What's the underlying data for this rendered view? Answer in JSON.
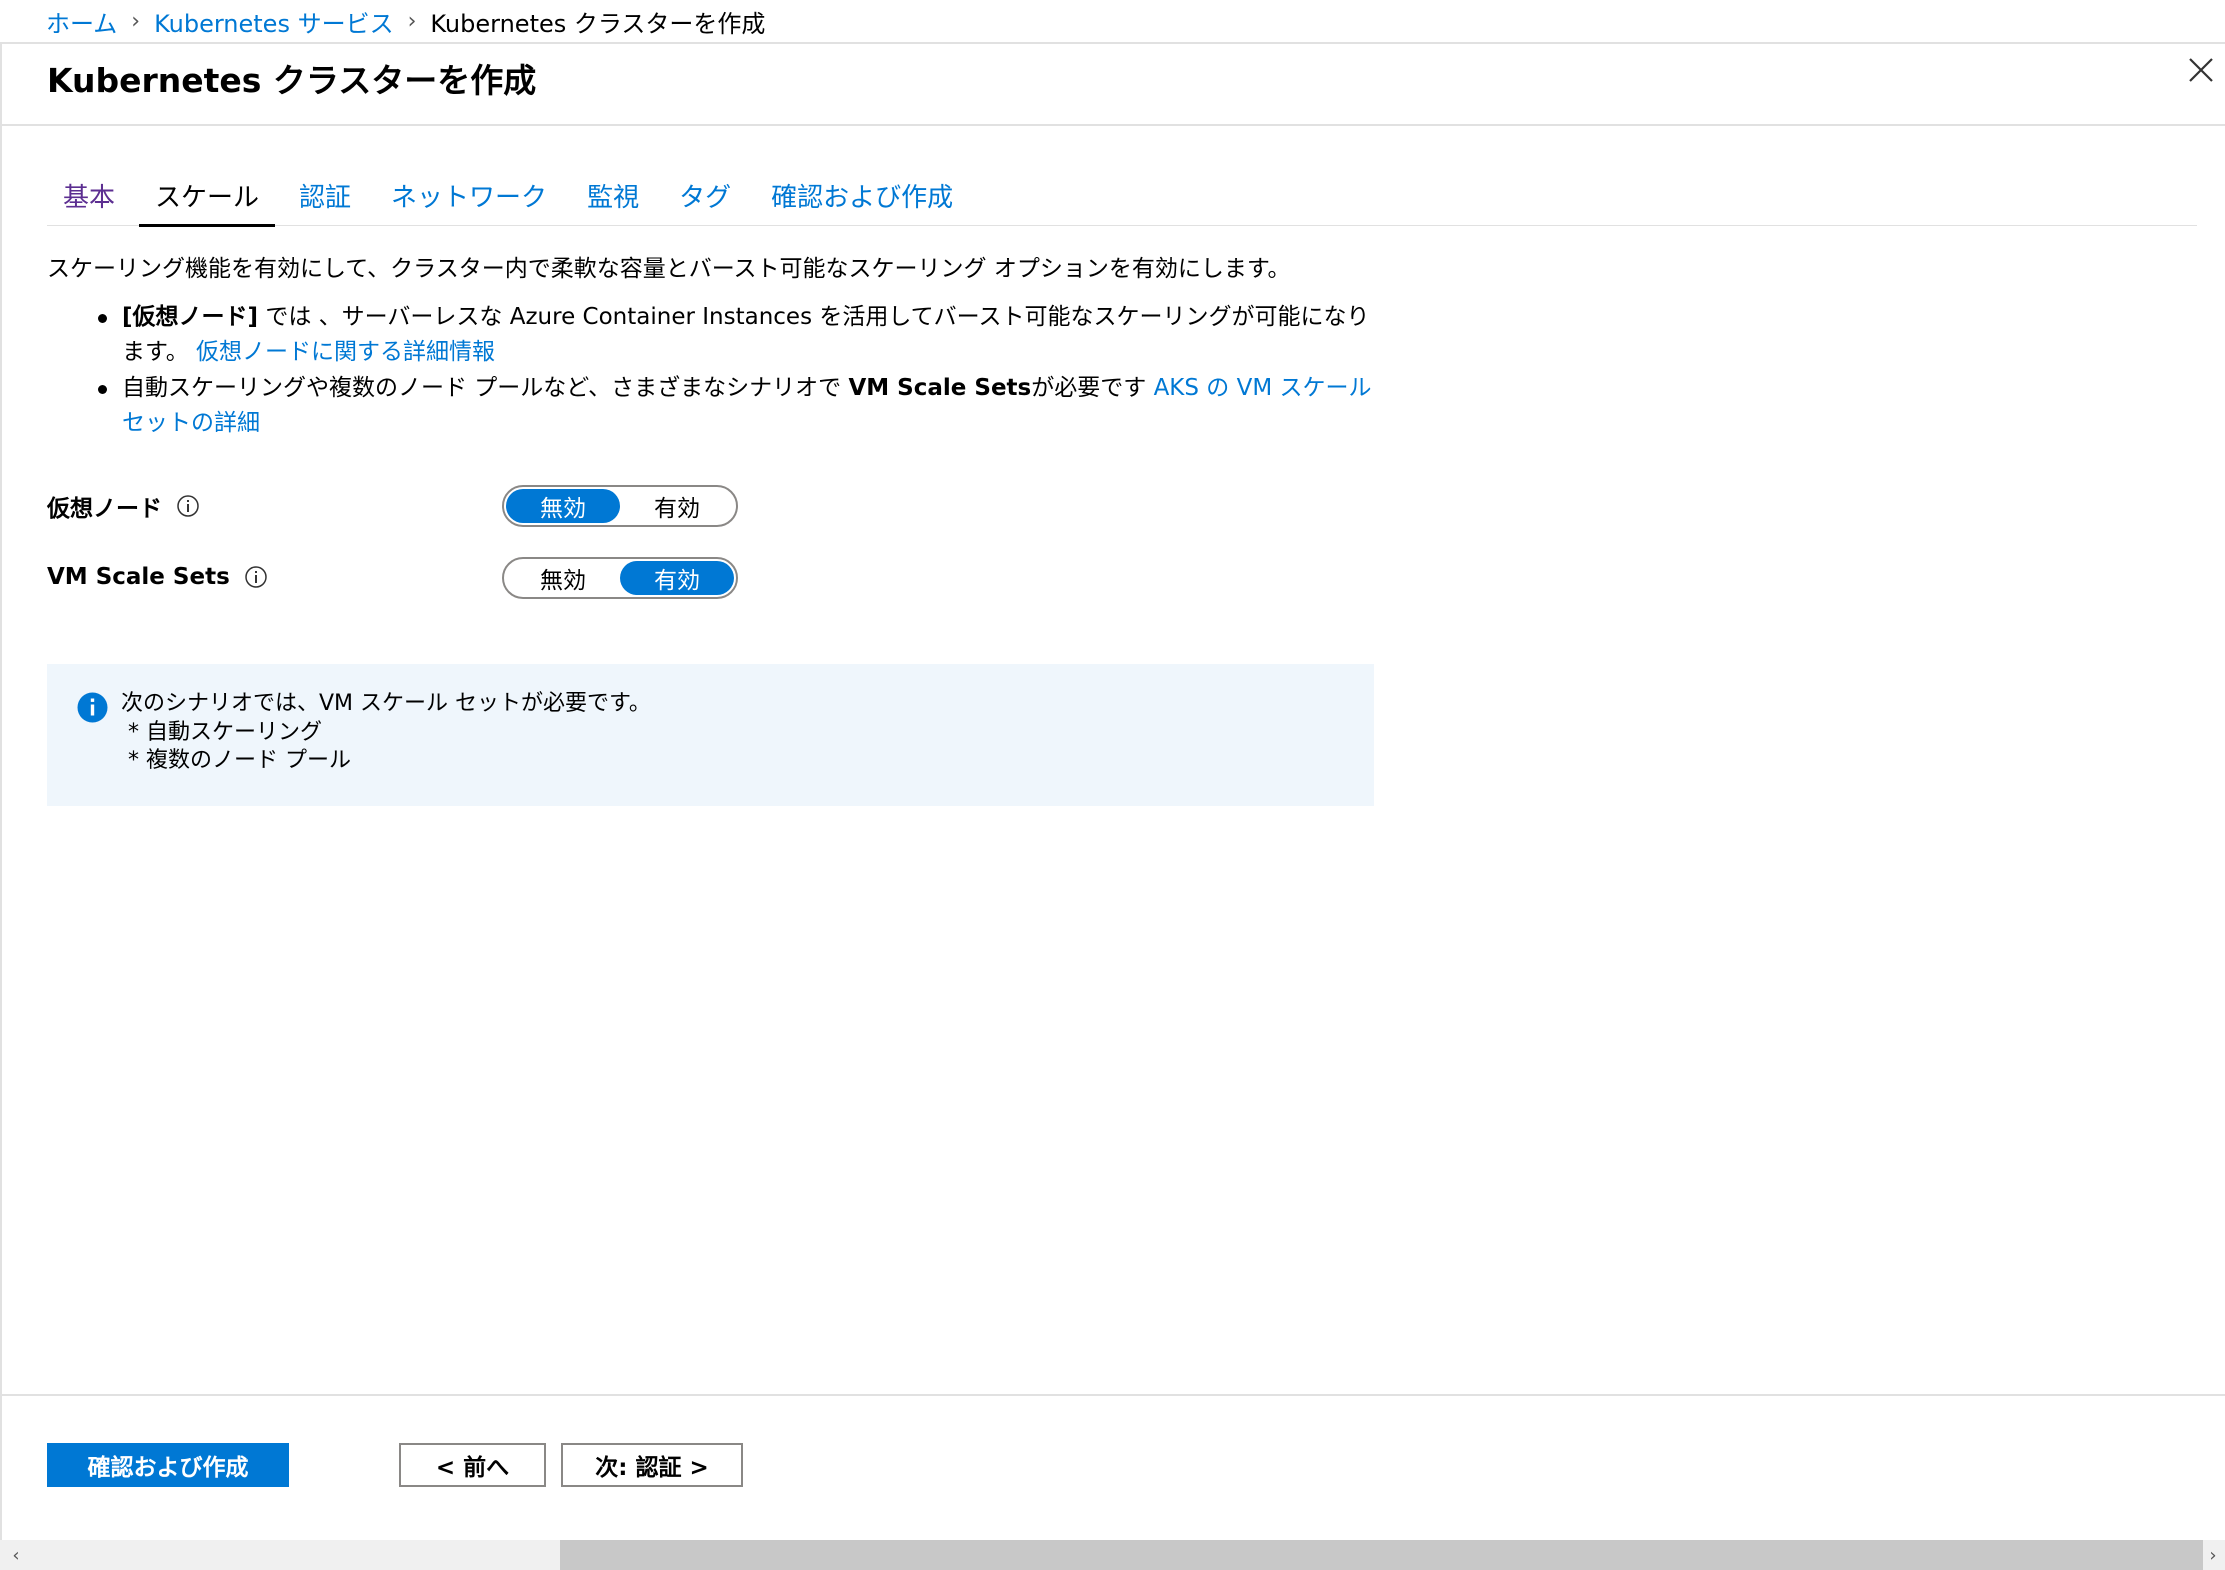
{
  "breadcrumb": {
    "home": "ホーム",
    "service": "Kubernetes サービス",
    "current": "Kubernetes クラスターを作成"
  },
  "header": {
    "title": "Kubernetes クラスターを作成"
  },
  "tabs": [
    {
      "label": "基本"
    },
    {
      "label": "スケール"
    },
    {
      "label": "認証"
    },
    {
      "label": "ネットワーク"
    },
    {
      "label": "監視"
    },
    {
      "label": "タグ"
    },
    {
      "label": "確認および作成"
    }
  ],
  "main": {
    "intro": "スケーリング機能を有効にして、クラスター内で柔軟な容量とバースト可能なスケーリング オプションを有効にします。",
    "bullet1": {
      "bold": "[仮想ノード]",
      "text": " では 、サーバーレスな Azure Container Instances を活用してバースト可能なスケーリングが可能になります。 ",
      "link": "仮想ノードに関する詳細情報"
    },
    "bullet2": {
      "text_pre": "自動スケーリングや複数のノード プールなど、さまざまなシナリオで ",
      "bold": "VM Scale Sets",
      "text_post": "が必要です ",
      "link": "AKS の VM スケール セットの詳細"
    },
    "virtual_nodes": {
      "label": "仮想ノード",
      "off": "無効",
      "on": "有効",
      "selected": "無効"
    },
    "vm_scale_sets": {
      "label": "VM Scale Sets",
      "off": "無効",
      "on": "有効",
      "selected": "有効"
    },
    "info_box": {
      "text": "次のシナリオでは、VM スケール セットが必要です。\n * 自動スケーリング\n * 複数のノード プール"
    }
  },
  "footer": {
    "review_create": "確認および作成",
    "previous": "< 前へ",
    "next": "次: 認証 >"
  },
  "colors": {
    "accent": "#0078d4",
    "visited": "#5c2e91",
    "info_bg": "#eff6fc"
  },
  "icons": [
    "chevron-right-icon",
    "close-icon",
    "info-icon",
    "info-filled-icon",
    "scroll-left-icon",
    "scroll-right-icon"
  ]
}
